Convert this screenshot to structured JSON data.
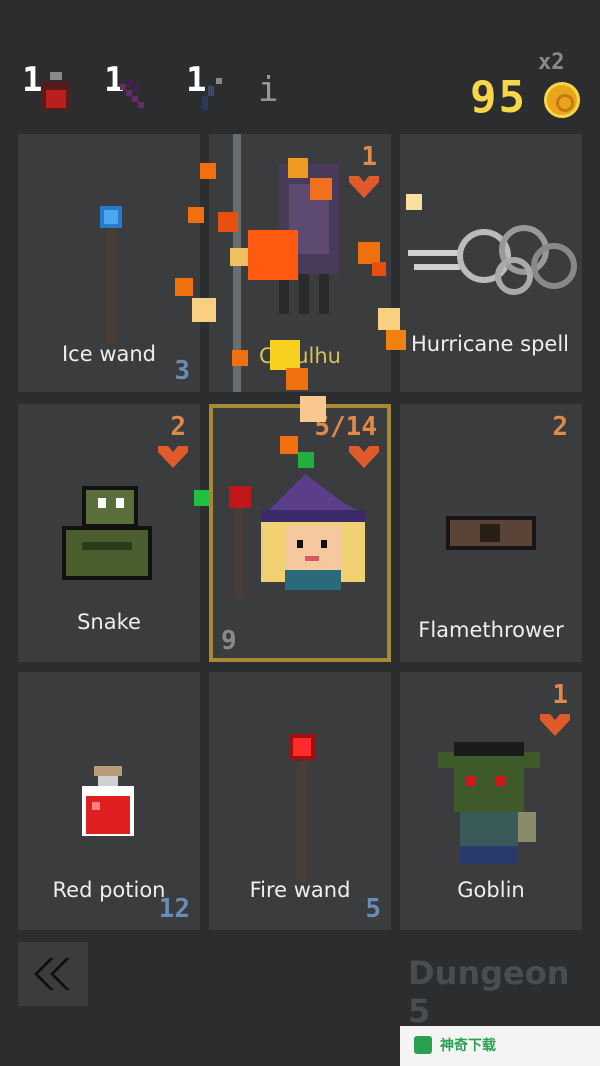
{
  "inventory": {
    "potion_count": "1",
    "sword_count": "1",
    "tool_count": "1",
    "info_label": "i"
  },
  "gold": {
    "multiplier": "x2",
    "amount": "95"
  },
  "cards": {
    "ice_wand": {
      "label": "Ice wand",
      "count": "3"
    },
    "cthulhu": {
      "label": "Cthulhu",
      "health": "1"
    },
    "hurricane": {
      "label": "Hurricane spell"
    },
    "snake": {
      "label": "Snake",
      "health": "2"
    },
    "hero": {
      "health": "5/14",
      "power": "9"
    },
    "flamethrower": {
      "label": "Flamethrower",
      "count": "2"
    },
    "red_potion": {
      "label": "Red potion",
      "count": "12"
    },
    "fire_wand": {
      "label": "Fire wand",
      "count": "5"
    },
    "goblin": {
      "label": "Goblin",
      "health": "1"
    }
  },
  "footer": {
    "back_label": "«",
    "dungeon_label": "Dungeon 5"
  },
  "watermark": {
    "text": "神奇下载"
  },
  "colors": {
    "background": "#2b2d2f",
    "card": "#3a3c3e",
    "gold": "#f8d64b",
    "health": "#e08a4a",
    "selected_border": "#a88a34"
  }
}
